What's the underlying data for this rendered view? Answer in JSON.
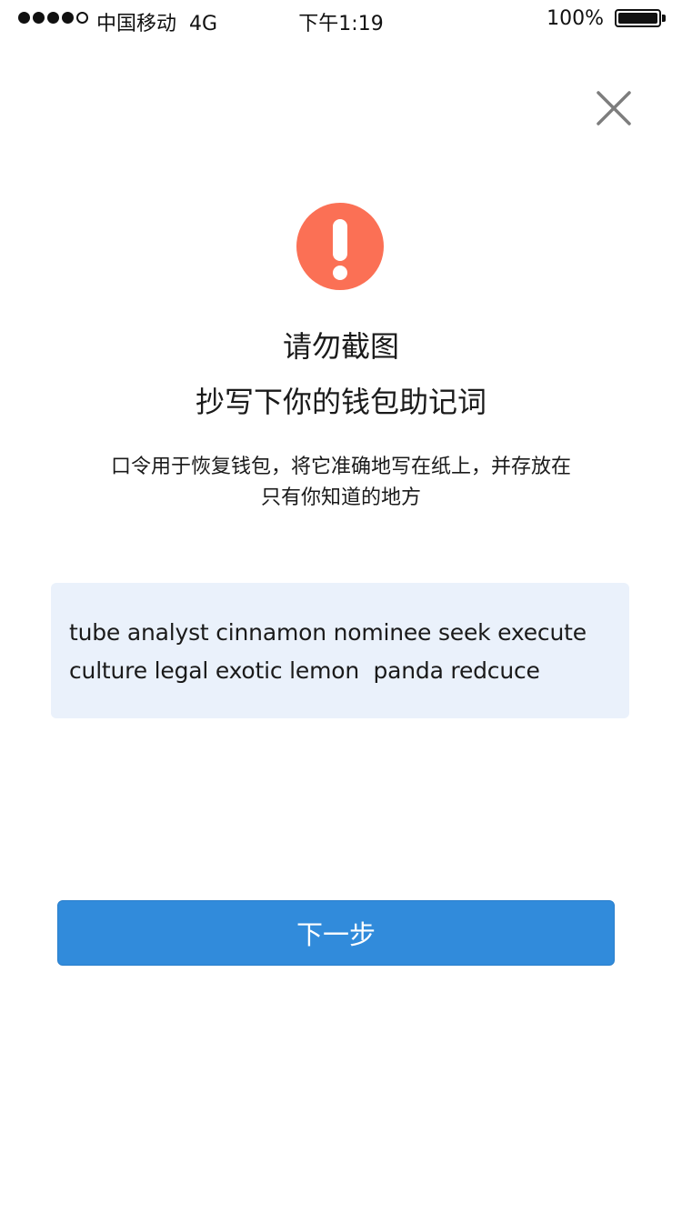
{
  "status_bar": {
    "carrier": "中国移动  4G",
    "time": "下午1:19",
    "battery": "100%",
    "signal_icon": "signal-dots-icon",
    "battery_icon": "battery-full-icon"
  },
  "header": {
    "close_icon": "close-icon"
  },
  "warning": {
    "icon": "exclamation-circle-icon",
    "color": "#fb7055"
  },
  "content": {
    "title_line_1": "请勿截图",
    "title_line_2": "抄写下你的钱包助记词",
    "description_line_1": "口令用于恢复钱包，将它准确地写在纸上，并存放在",
    "description_line_2": "只有你知道的地方"
  },
  "mnemonic": {
    "line_1": "tube analyst cinnamon nominee seek execute",
    "line_2": "culture legal exotic lemon  panda redcuce",
    "background": "#eaf1fb"
  },
  "actions": {
    "next_label": "下一步",
    "button_color": "#318bdb"
  }
}
